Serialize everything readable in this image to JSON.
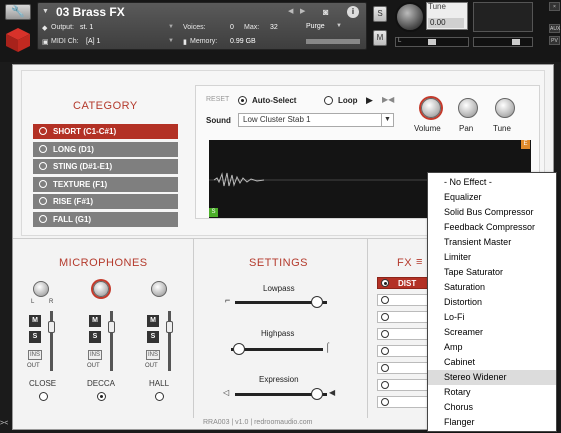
{
  "header": {
    "instrument_name": "03 Brass FX",
    "output_label": "Output:",
    "output_value": "st. 1",
    "midi_label": "MIDI Ch:",
    "midi_value": "[A] 1",
    "voices_label": "Voices:",
    "voices_value": "0",
    "max_label": "Max:",
    "max_value": "32",
    "memory_label": "Memory:",
    "memory_value": "0.99 GB",
    "purge_label": "Purge",
    "s_label": "S",
    "m_label": "M",
    "tune_label": "Tune",
    "tune_value": "0.00",
    "pan_label": "L",
    "side_buttons": [
      "×",
      "AUX",
      "PV"
    ]
  },
  "category": {
    "title": "CATEGORY",
    "items": [
      {
        "label": "SHORT (C1-C#1)",
        "selected": true
      },
      {
        "label": "LONG (D1)",
        "selected": false
      },
      {
        "label": "STING (D#1-E1)",
        "selected": false
      },
      {
        "label": "TEXTURE (F1)",
        "selected": false
      },
      {
        "label": "RISE (F#1)",
        "selected": false
      },
      {
        "label": "FALL (G1)",
        "selected": false
      }
    ]
  },
  "sound": {
    "reset_label": "RESET",
    "auto_select_label": "Auto-Select",
    "loop_label": "Loop",
    "sound_label": "Sound",
    "sound_value": "Low Cluster Stab 1",
    "volume_label": "Volume",
    "pan_label": "Pan",
    "tune_label": "Tune",
    "wave_start_marker": "S",
    "wave_end_marker": "E"
  },
  "microphones": {
    "title": "MICROPHONES",
    "mics": [
      {
        "label": "CLOSE",
        "selected": false
      },
      {
        "label": "DECCA",
        "selected": true
      },
      {
        "label": "HALL",
        "selected": false
      }
    ],
    "m_label": "M",
    "s_label": "S",
    "ins_label": "INS",
    "out_label": "OUT",
    "knob_left": "L",
    "knob_right": "R"
  },
  "settings": {
    "title": "SETTINGS",
    "lowpass_label": "Lowpass",
    "highpass_label": "Highpass",
    "expression_label": "Expression"
  },
  "fx": {
    "title": "FX",
    "first_slot": "DIST"
  },
  "footer": {
    "text": "RRA003  |  v1.0  |  redroomaudio.com"
  },
  "fx_menu": {
    "items": [
      "- No Effect -",
      "Equalizer",
      "Solid Bus Compressor",
      "Feedback Compressor",
      "Transient Master",
      "Limiter",
      "Tape Saturator",
      "Saturation",
      "Distortion",
      "Lo-Fi",
      "Screamer",
      "Amp",
      "Cabinet",
      "Stereo Widener",
      "Rotary",
      "Chorus",
      "Flanger"
    ],
    "highlighted": "Stereo Widener"
  }
}
